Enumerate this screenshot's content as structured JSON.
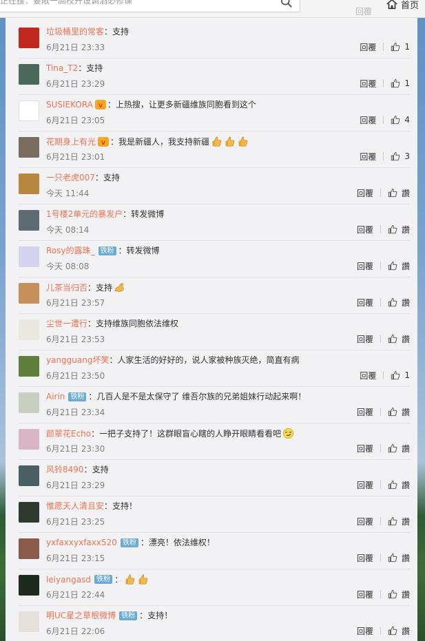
{
  "topbar": {
    "search_placeholder": "正在搜：要敞一高校开设调酒必修课",
    "home_label": "首页",
    "faded_text": "回覆"
  },
  "comments": [
    {
      "user": "垃圾桶里的常客",
      "fan_badge": "",
      "has_v": false,
      "text": "支持",
      "emoji": [],
      "time": "6月21日 23:33",
      "reply": "回覆",
      "likes": "1",
      "avatar_color": "#c0271e"
    },
    {
      "user": "Tina_T2",
      "fan_badge": "",
      "has_v": false,
      "text": "支持",
      "emoji": [],
      "time": "6月21日 23:29",
      "reply": "回覆",
      "likes": "1",
      "avatar_color": "#4b6a5b"
    },
    {
      "user": "SUSIEKORA",
      "fan_badge": "",
      "has_v": true,
      "text": "上热搜，让更多新疆维族同胞看到这个",
      "emoji": [],
      "time": "6月21日 23:05",
      "reply": "回覆",
      "likes": "4",
      "avatar_color": "#ffffff"
    },
    {
      "user": "花期身上有光",
      "fan_badge": "",
      "has_v": true,
      "text": "我是新疆人，我支持新疆",
      "emoji": [
        "thumb",
        "thumb",
        "thumb"
      ],
      "time": "6月21日 23:01",
      "reply": "回覆",
      "likes": "3",
      "avatar_color": "#7a6c5e"
    },
    {
      "user": "一只老虎007",
      "fan_badge": "",
      "has_v": false,
      "text": "支持",
      "emoji": [],
      "time": "今天 11:44",
      "reply": "回覆",
      "likes": "讚",
      "avatar_color": "#b8873f"
    },
    {
      "user": "1号楼2单元的暴发户",
      "fan_badge": "",
      "has_v": false,
      "text": "转发微博",
      "emoji": [],
      "time": "今天 08:14",
      "reply": "回覆",
      "likes": "讚",
      "avatar_color": "#5d6b72"
    },
    {
      "user": "Rosy的露珠_",
      "fan_badge": "铁粉",
      "has_v": false,
      "text": "转发微博",
      "emoji": [],
      "time": "今天 08:08",
      "reply": "回覆",
      "likes": "讚",
      "avatar_color": "#d4d4f0"
    },
    {
      "user": "儿茶当归否",
      "fan_badge": "",
      "has_v": false,
      "text": "支持",
      "emoji": [
        "muscle"
      ],
      "time": "6月21日 23:57",
      "reply": "回覆",
      "likes": "讚",
      "avatar_color": "#c7905a"
    },
    {
      "user": "尘世一遭行",
      "fan_badge": "",
      "has_v": false,
      "text": "支持维族同胞依法维权",
      "emoji": [],
      "time": "6月21日 23:53",
      "reply": "回覆",
      "likes": "讚",
      "avatar_color": "#e9e9e0"
    },
    {
      "user": "yangguang坏笑",
      "fan_badge": "",
      "has_v": false,
      "text": "人家生活的好好的，说人家被种族灭绝，简直有病",
      "emoji": [],
      "time": "6月21日 23:50",
      "reply": "回覆",
      "likes": "1",
      "avatar_color": "#5f7f3a"
    },
    {
      "user": "Airin",
      "fan_badge": "铁粉",
      "has_v": false,
      "text": "几百人是不是太保守了 维吾尔族的兄弟姐妹行动起来啊！",
      "emoji": [],
      "time": "6月21日 23:34",
      "reply": "回覆",
      "likes": "讚",
      "avatar_color": "#c9cfc0"
    },
    {
      "user": "颜翠花Echo",
      "fan_badge": "",
      "has_v": false,
      "text": "一把子支持了！这群眼盲心瞎的人睁开眼睛看看吧",
      "emoji": [
        "smirk"
      ],
      "time": "6月21日 23:30",
      "reply": "回覆",
      "likes": "讚",
      "avatar_color": "#d9b4c4"
    },
    {
      "user": "风铃8490",
      "fan_badge": "",
      "has_v": false,
      "text": "支持",
      "emoji": [],
      "time": "6月21日 23:29",
      "reply": "回覆",
      "likes": "讚",
      "avatar_color": "#4a5f63"
    },
    {
      "user": "惟愿天人清且安",
      "fan_badge": "",
      "has_v": false,
      "text": "支持！",
      "emoji": [],
      "time": "6月21日 23:25",
      "reply": "回覆",
      "likes": "讚",
      "avatar_color": "#2e3a2f"
    },
    {
      "user": "yxfaxxyxfaxx520",
      "fan_badge": "铁粉",
      "has_v": false,
      "text": "漂亮！依法维权！",
      "emoji": [],
      "time": "6月21日 23:15",
      "reply": "回覆",
      "likes": "讚",
      "avatar_color": "#8a5a4a"
    },
    {
      "user": "leiyangasd",
      "fan_badge": "铁粉",
      "has_v": false,
      "text": "",
      "emoji": [
        "thumb",
        "thumb"
      ],
      "time": "6月21日 22:44",
      "reply": "回覆",
      "likes": "讚",
      "avatar_color": "#1d2a1d"
    },
    {
      "user": "明UC星之草根微博",
      "fan_badge": "铁粉",
      "has_v": false,
      "text": "支持！",
      "emoji": [],
      "time": "6月21日 22:06",
      "reply": "回覆",
      "likes": "讚",
      "avatar_color": "#e6e0da"
    }
  ]
}
